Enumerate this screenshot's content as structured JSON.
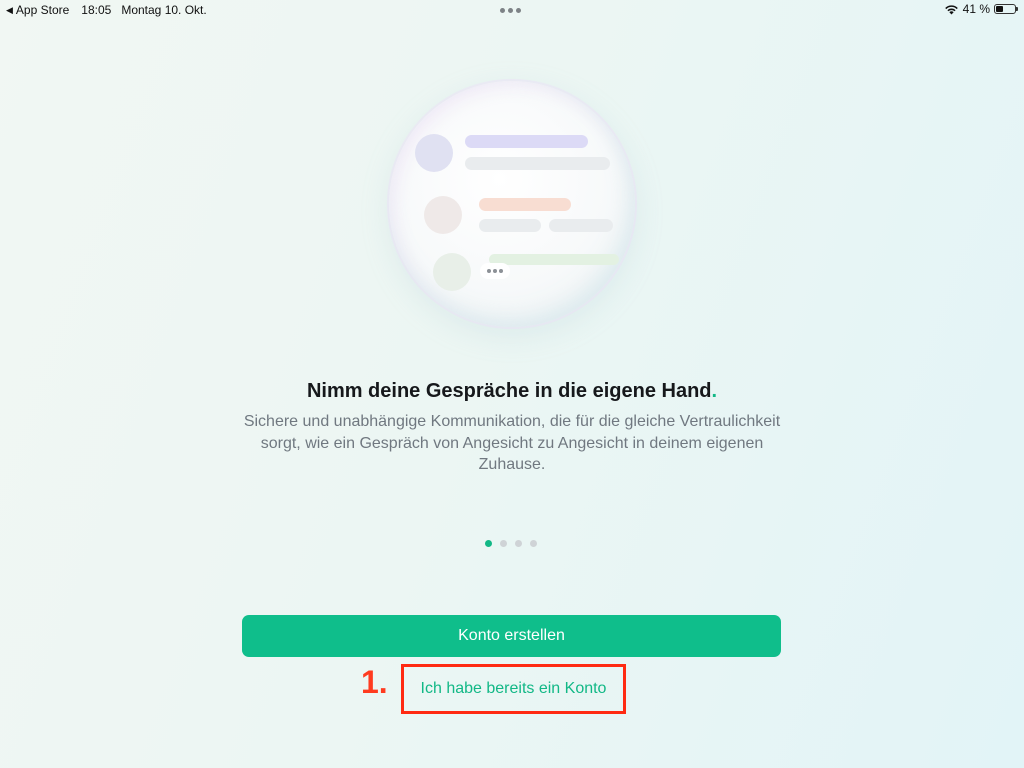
{
  "status_bar": {
    "back_app": "App Store",
    "time": "18:05",
    "date": "Montag 10. Okt.",
    "battery_percent": "41 %",
    "battery_level": 0.41
  },
  "onboarding": {
    "title": "Nimm deine Gespräche in die eigene Hand",
    "title_dot": ".",
    "subtitle": "Sichere und unabhängige Kommunikation, die für die gleiche Vertraulichkeit sorgt, wie ein Gespräch von Angesicht zu Angesicht in deinem eigenen Zuhause.",
    "pager": {
      "pages": 4,
      "current": 1
    }
  },
  "actions": {
    "create_account": "Konto erstellen",
    "have_account": "Ich habe bereits ein Konto"
  },
  "annotation": {
    "step_label": "1.",
    "color": "#ff2a12"
  },
  "colors": {
    "accent": "#12b886",
    "button": "#0fbe8b"
  }
}
